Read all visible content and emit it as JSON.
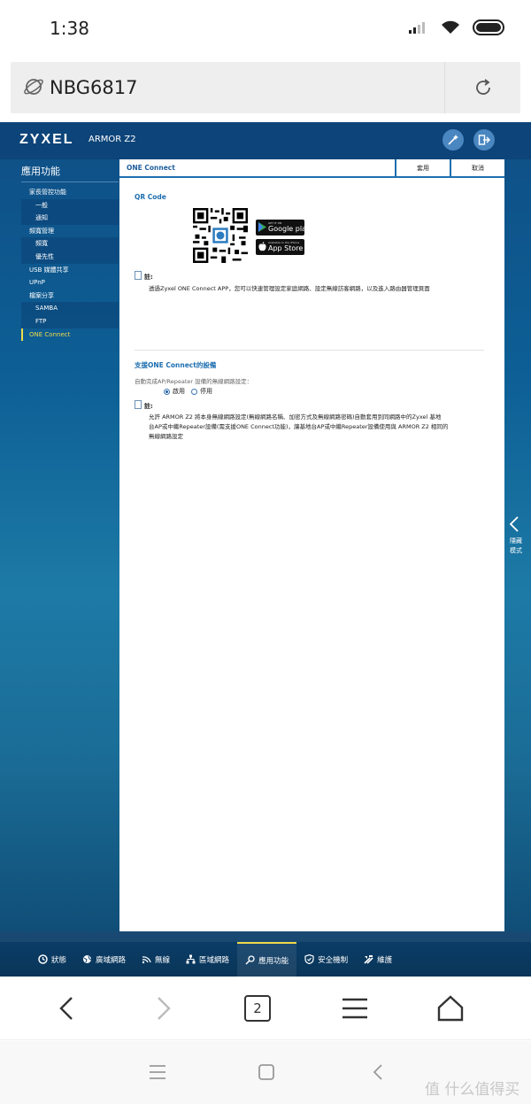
{
  "status": {
    "time": "1:38"
  },
  "browser": {
    "url": "NBG6817",
    "tab_count": "2"
  },
  "router": {
    "brand": "ZYXEL",
    "model": "ARMOR Z2",
    "sidebar": {
      "title": "應用功能",
      "items": [
        {
          "label": "家長管控功能",
          "type": "main"
        },
        {
          "label": "一般",
          "type": "sub"
        },
        {
          "label": "通知",
          "type": "sub"
        },
        {
          "label": "頻寬管理",
          "type": "main"
        },
        {
          "label": "頻寬",
          "type": "sub"
        },
        {
          "label": "優先性",
          "type": "sub"
        },
        {
          "label": "USB 媒體共享",
          "type": "main"
        },
        {
          "label": "UPnP",
          "type": "main"
        },
        {
          "label": "檔案分享",
          "type": "main"
        },
        {
          "label": "SAMBA",
          "type": "sub"
        },
        {
          "label": "FTP",
          "type": "sub"
        },
        {
          "label": "ONE Connect",
          "type": "active"
        }
      ]
    },
    "panel": {
      "title": "ONE Connect",
      "apply_label": "套用",
      "cancel_label": "取消",
      "qr_title": "QR Code",
      "google_play_sub": "GET IT ON",
      "google_play_label": "Google play",
      "app_store_sub": "Available on the iPhone",
      "app_store_label": "App Store",
      "note1_label": "註:",
      "note1_text": "透過Zyxel ONE Connect APP，您可以快速管理設定家庭網路、設定無線訪客網路，以及進入路由器管理頁面",
      "section2_title": "支援ONE Connect的設備",
      "auto_label": "自動完成AP/Repeater 設備的無線網路設定：",
      "radio_enable": "啟用",
      "radio_disable": "停用",
      "radio_selected": "enable",
      "note2_label": "註:",
      "note2_lines": [
        "允許 ARMOR Z2 將本身無線網路設定(無線網路名稱、加密方式及無線網路密碼)自動套用到同網路中的Zyxel 基地",
        "台AP或中繼Repeater設備(需支援ONE Connect功能)，讓基地台AP或中繼Repeater設備使用與 ARMOR Z2 相同的",
        "無線網路設定"
      ]
    },
    "side_tab": {
      "line1": "隱藏",
      "line2": "模式"
    },
    "bottom_nav": [
      {
        "label": "狀態",
        "icon": "status-icon"
      },
      {
        "label": "廣域網路",
        "icon": "globe-icon"
      },
      {
        "label": "無線",
        "icon": "wifi-icon"
      },
      {
        "label": "區域網路",
        "icon": "lan-icon"
      },
      {
        "label": "應用功能",
        "icon": "app-icon",
        "active": true
      },
      {
        "label": "安全機制",
        "icon": "shield-icon"
      },
      {
        "label": "維護",
        "icon": "tools-icon"
      }
    ]
  },
  "watermark": "值 什么值得买"
}
